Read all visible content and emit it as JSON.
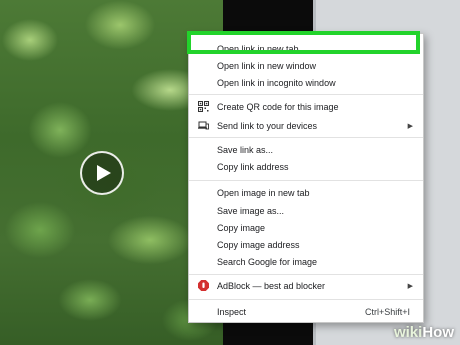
{
  "menu": {
    "items": [
      {
        "label": "Open link in new tab"
      },
      {
        "label": "Open link in new window"
      },
      {
        "label": "Open link in incognito window"
      },
      {
        "label": "Create QR code for this image",
        "icon": "qr-code-icon"
      },
      {
        "label": "Send link to your devices",
        "icon": "devices-icon",
        "submenu": true
      },
      {
        "label": "Save link as..."
      },
      {
        "label": "Copy link address"
      },
      {
        "label": "Open image in new tab"
      },
      {
        "label": "Save image as..."
      },
      {
        "label": "Copy image"
      },
      {
        "label": "Copy image address"
      },
      {
        "label": "Search Google for image"
      },
      {
        "label": "AdBlock — best ad blocker",
        "icon": "adblock-icon",
        "submenu": true
      },
      {
        "label": "Inspect",
        "shortcut": "Ctrl+Shift+I"
      }
    ]
  },
  "colors": {
    "highlight": "#22d32b",
    "adblock": "#d32f2f"
  },
  "watermark": {
    "part1": "wiki",
    "part2": "How"
  },
  "video": {
    "play_icon": "play-icon"
  }
}
